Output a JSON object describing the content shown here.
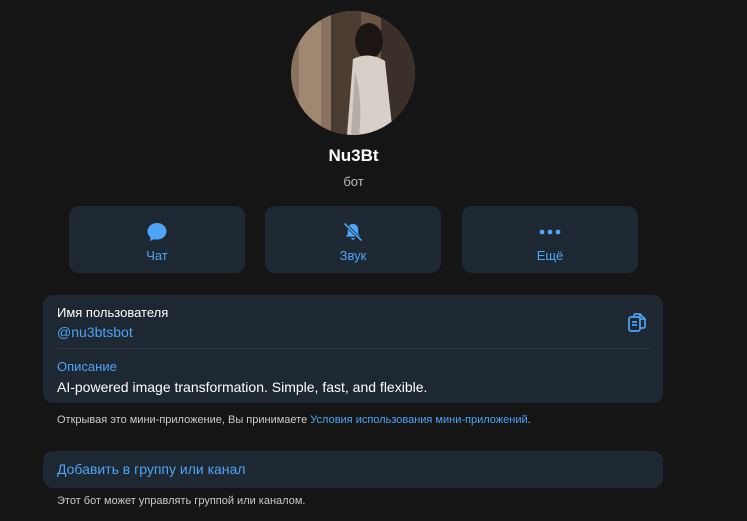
{
  "profile": {
    "name": "Nu3Bt",
    "subtitle": "бот"
  },
  "actions": [
    {
      "label": "Чат",
      "icon": "chat-bubble-icon"
    },
    {
      "label": "Звук",
      "icon": "bell-muted-icon"
    },
    {
      "label": "Ещё",
      "icon": "more-dots-icon"
    }
  ],
  "info": {
    "username_title": "Имя пользователя",
    "username": "@nu3btsbot",
    "copy_icon": "copy-icon",
    "description_title": "Описание",
    "description": "AI-powered image transformation. Simple, fast, and flexible."
  },
  "notice": {
    "text": "Открывая это мини-приложение, Вы принимаете ",
    "link": "Условия использования мини-приложений",
    "end": "."
  },
  "add_to_group": {
    "label": "Добавить в группу или канал",
    "footnote": "Этот бот может управлять группой или каналом."
  },
  "colors": {
    "background": "#151515",
    "card": "#1e2833",
    "accent": "#4ea4f6"
  }
}
